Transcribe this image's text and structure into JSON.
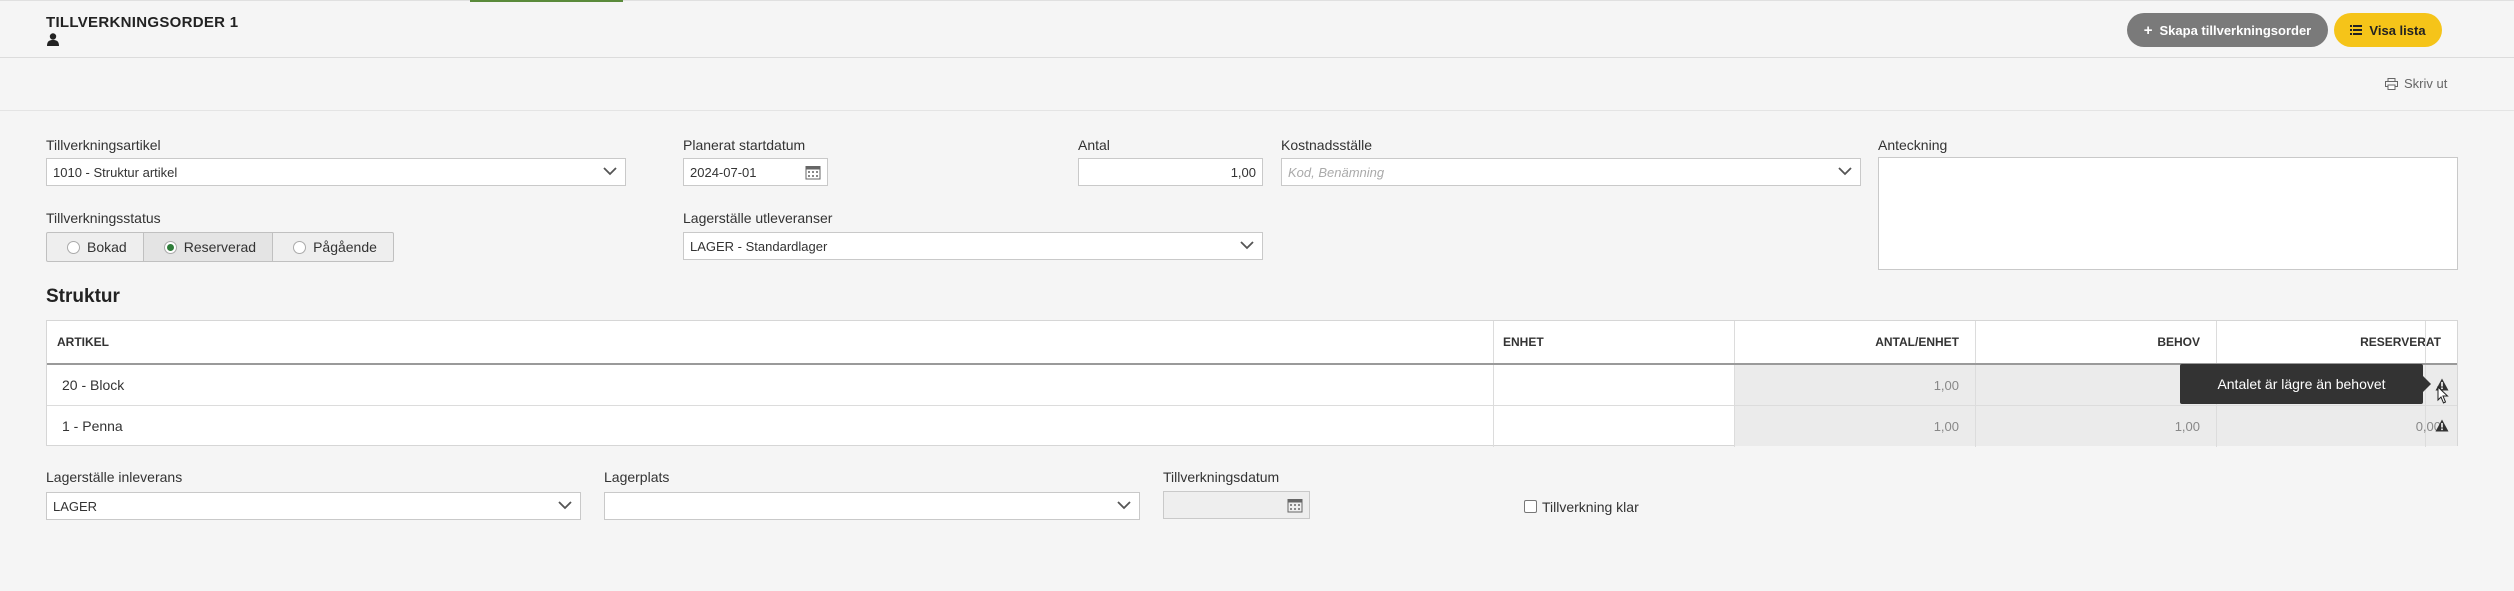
{
  "header": {
    "title": "TILLVERKNINGSORDER 1",
    "create_button": "Skapa tillverkningsorder",
    "list_button": "Visa lista",
    "print_label": "Skriv ut"
  },
  "form": {
    "article_label": "Tillverkningsartikel",
    "article_value": "1010 - Struktur artikel",
    "start_label": "Planerat startdatum",
    "start_value": "2024-07-01",
    "quantity_label": "Antal",
    "quantity_value": "1,00",
    "cost_center_label": "Kostnadsställe",
    "cost_center_placeholder": "Kod, Benämning",
    "note_label": "Anteckning",
    "status_label": "Tillverkningsstatus",
    "status_options": [
      "Bokad",
      "Reserverad",
      "Pågående"
    ],
    "status_selected": "Reserverad",
    "warehouse_out_label": "Lagerställe utleveranser",
    "warehouse_out_value": "LAGER - Standardlager"
  },
  "structure": {
    "title": "Struktur",
    "columns": [
      "ARTIKEL",
      "ENHET",
      "ANTAL/ENHET",
      "BEHOV",
      "RESERVERAT"
    ],
    "rows": [
      {
        "article": "20 - Block",
        "unit": "",
        "qty_per_unit": "1,00",
        "need": "",
        "reserved": ""
      },
      {
        "article": "1 - Penna",
        "unit": "",
        "qty_per_unit": "1,00",
        "need": "1,00",
        "reserved": "0,00"
      }
    ],
    "tooltip": "Antalet är lägre än behovet"
  },
  "footer": {
    "warehouse_in_label": "Lagerställe inleverans",
    "warehouse_in_value": "LAGER",
    "location_label": "Lagerplats",
    "location_value": "",
    "production_date_label": "Tillverkningsdatum",
    "production_date_value": "",
    "done_label": "Tillverkning klar",
    "done_checked": false
  },
  "colors": {
    "accent_green": "#2f7d3a",
    "button_gray": "#7a7a7a",
    "button_yellow": "#f5c419"
  }
}
